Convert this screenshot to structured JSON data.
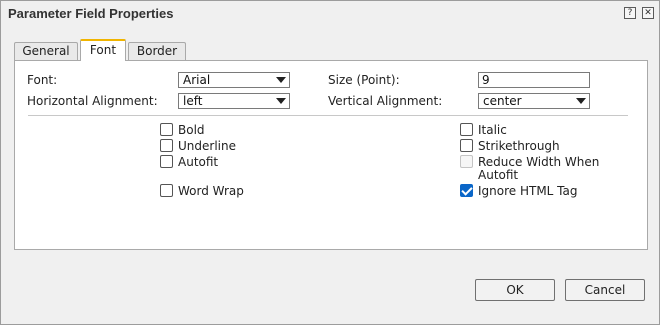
{
  "dialog": {
    "title": "Parameter Field Properties",
    "help_label": "?",
    "close_label": "✕"
  },
  "tabs": [
    {
      "label": "General",
      "active": false
    },
    {
      "label": "Font",
      "active": true
    },
    {
      "label": "Border",
      "active": false
    }
  ],
  "font_tab": {
    "font_label": "Font:",
    "font_value": "Arial",
    "size_label": "Size (Point):",
    "size_value": "9",
    "halign_label": "Horizontal Alignment:",
    "halign_value": "left",
    "valign_label": "Vertical Alignment:",
    "valign_value": "center",
    "options": {
      "bold": {
        "label": "Bold",
        "checked": false,
        "enabled": true
      },
      "underline": {
        "label": "Underline",
        "checked": false,
        "enabled": true
      },
      "autofit": {
        "label": "Autofit",
        "checked": false,
        "enabled": true
      },
      "word_wrap": {
        "label": "Word Wrap",
        "checked": false,
        "enabled": true
      },
      "italic": {
        "label": "Italic",
        "checked": false,
        "enabled": true
      },
      "strikethrough": {
        "label": "Strikethrough",
        "checked": false,
        "enabled": true
      },
      "reduce_width": {
        "label_line1": "Reduce Width When",
        "label_line2": "Autofit",
        "checked": false,
        "enabled": false
      },
      "ignore_html": {
        "label": "Ignore HTML Tag",
        "checked": true,
        "enabled": true
      }
    }
  },
  "buttons": {
    "ok_label": "OK",
    "cancel_label": "Cancel"
  },
  "colors": {
    "active_tab_accent": "#f0b400",
    "checkbox_checked": "#0a66c8"
  }
}
